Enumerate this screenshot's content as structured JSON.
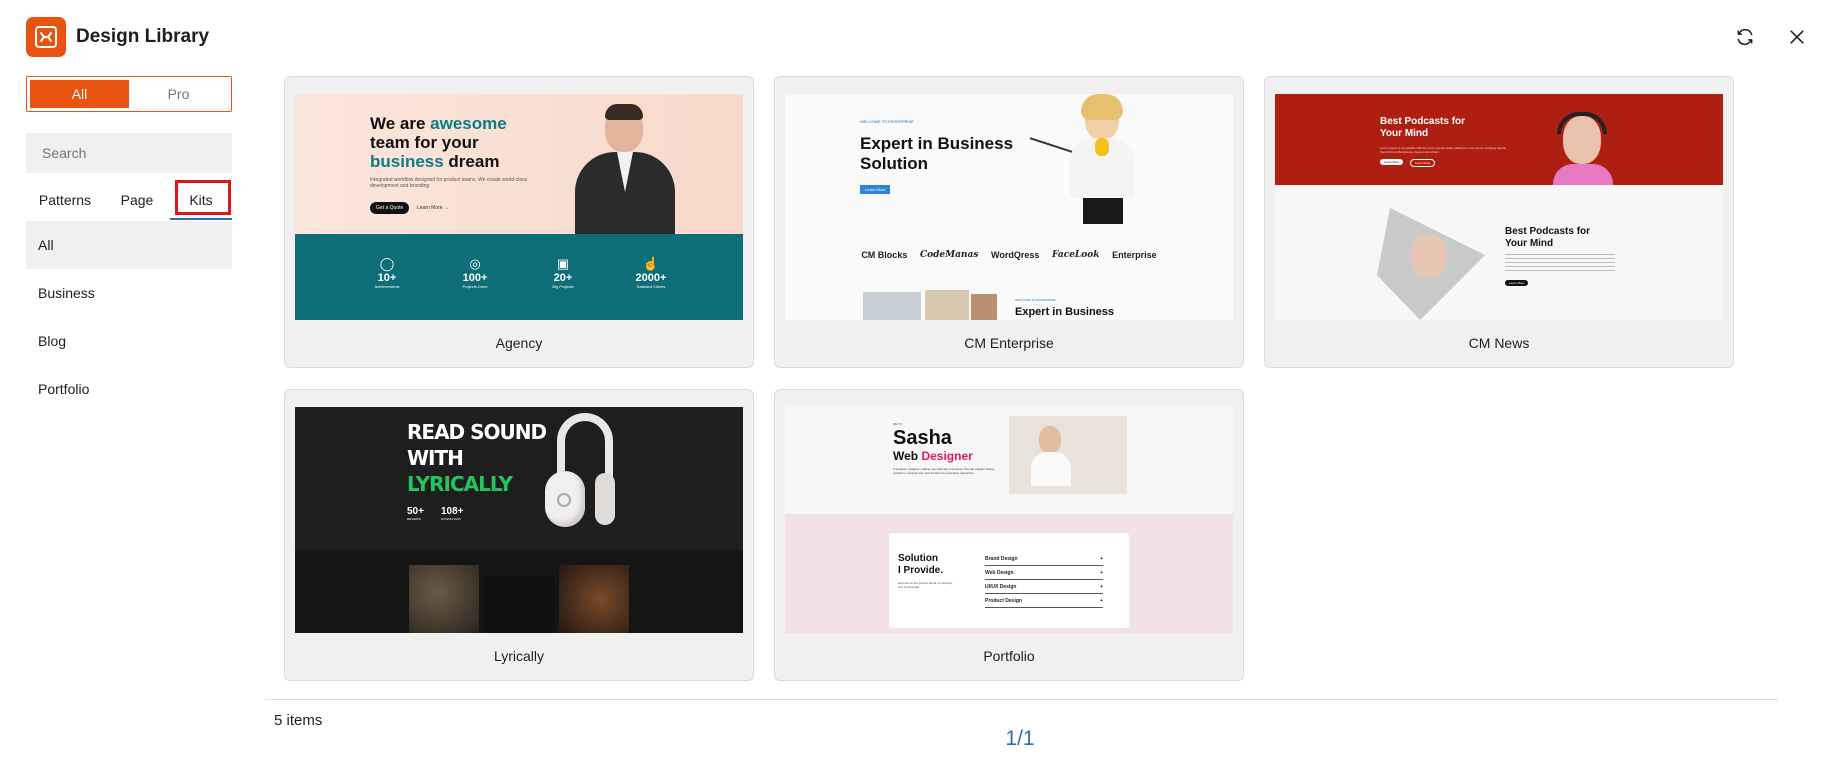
{
  "header": {
    "title": "Design Library",
    "logo_icon": "library-logo-icon",
    "refresh_icon": "refresh-icon",
    "close_icon": "close-icon"
  },
  "colors": {
    "accent": "#e8540f",
    "link": "#2f6ea8",
    "highlight": "#e0151d"
  },
  "sidebar": {
    "segmented": {
      "all": "All",
      "pro": "Pro",
      "selected": "All"
    },
    "search": {
      "placeholder": "Search",
      "value": ""
    },
    "tabs": [
      {
        "label": "Patterns"
      },
      {
        "label": "Page"
      },
      {
        "label": "Kits"
      }
    ],
    "active_tab": "Kits",
    "categories": [
      {
        "label": "All"
      },
      {
        "label": "Business"
      },
      {
        "label": "Blog"
      },
      {
        "label": "Portfolio"
      }
    ],
    "active_category": "All"
  },
  "items": [
    {
      "label": "Agency",
      "preview": {
        "headline_1": "We are ",
        "headline_accent": "awesome",
        "headline_2": "team for your",
        "headline_3_accent": "business",
        "headline_3": " dream",
        "body": "Integrated workflow designed for product teams. We create world-class development and branding",
        "cta": "Get a Quote",
        "link": "Learn More →",
        "stats": [
          {
            "value": "10+",
            "label": "Achievements"
          },
          {
            "value": "100+",
            "label": "Projects Done"
          },
          {
            "value": "20+",
            "label": "Big Projects"
          },
          {
            "value": "2000+",
            "label": "Satisfied Clients"
          }
        ]
      }
    },
    {
      "label": "CM Enterprise",
      "preview": {
        "eyebrow": "WELCOME TO ENTERPRISE",
        "headline_1": "Expert in Business",
        "headline_2": "Solution",
        "cta": "Learn More",
        "brands": [
          "CM Blocks",
          "CodeManas",
          "WordQress",
          "FaceLook",
          "Enterprise"
        ],
        "eyebrow_2": "WELCOME TO ENTERPRISE",
        "headline_3": "Expert in Business"
      }
    },
    {
      "label": "CM News",
      "preview": {
        "headline_1": "Best Podcasts for",
        "headline_2": "Your Mind",
        "body": "Lorem ipsum is compatible with the most popular audio platforms in the world, including Spotify, SoundCloud, Bandcamp, Deezer and others.",
        "cta_1": "Learn More",
        "cta_2": "Learn More",
        "headline_3": "Best Podcasts for",
        "headline_4": "Your Mind",
        "cta_3": "Learn More"
      }
    },
    {
      "label": "Lyrically",
      "preview": {
        "line_1": "READ SOUND",
        "line_2": "WITH",
        "line_3": "LYRICALLY",
        "stat_1_value": "50+",
        "stat_1_label": "REVIEWS",
        "stat_2_value": "108+",
        "stat_2_label": "DOWNLOADS"
      }
    },
    {
      "label": "Portfolio",
      "preview": {
        "eyebrow": "ME TO",
        "name": "Sasha",
        "role_1": "Web ",
        "role_accent": "Designer",
        "body": "Freelancer designer crafting user-friendly experience through elegant design solutions, merging form and function for seamless interaction.",
        "solution_1": "Solution",
        "solution_2": "I Provide.",
        "solution_body": "Experience the perfect blend of creativity and functionality.",
        "services": [
          "Brand Design",
          "Web Design",
          "UI/UX Design",
          "Product Design"
        ]
      }
    }
  ],
  "footer": {
    "count": "5 items",
    "pagination": "1/1"
  }
}
